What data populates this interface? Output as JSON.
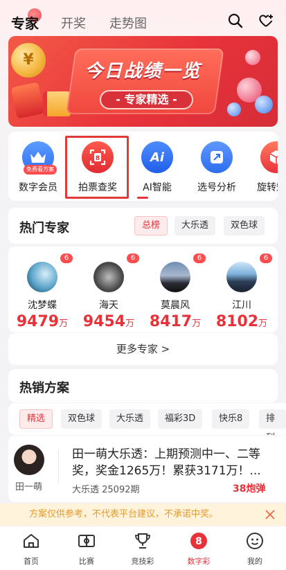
{
  "top_nav": {
    "tabs": [
      {
        "label": "专家",
        "active": true
      },
      {
        "label": "开奖",
        "active": false
      },
      {
        "label": "走势图",
        "active": false
      }
    ],
    "icons": [
      "search-icon",
      "heart-plus-icon"
    ]
  },
  "banner": {
    "title": "今日战绩一览",
    "subtitle": "- 专家精选 -",
    "coin_symbol": "¥"
  },
  "quick_functions": [
    {
      "label": "数字会员",
      "icon": "crown-icon",
      "badge": "免费看方案",
      "color": "#3b82f6"
    },
    {
      "label": "拍票查奖",
      "icon": "scan-ticket-icon",
      "badge": "",
      "color": "#e8323a",
      "highlighted": true
    },
    {
      "label": "AI智能",
      "icon": "ai-icon",
      "badge": "",
      "color": "#2f6ff2"
    },
    {
      "label": "选号分析",
      "icon": "select-number-icon",
      "badge": "",
      "color": "#3d7bf7"
    },
    {
      "label": "旋转矩阵",
      "icon": "cube-icon",
      "badge": "",
      "color": "#ef4b4b"
    }
  ],
  "hot_experts": {
    "title": "热门专家",
    "filters": [
      {
        "label": "总榜",
        "active": true
      },
      {
        "label": "大乐透",
        "active": false
      },
      {
        "label": "双色球",
        "active": false
      }
    ],
    "experts": [
      {
        "name": "沈梦蝶",
        "value": "9479",
        "unit": "万",
        "badge": "6"
      },
      {
        "name": "海天",
        "value": "9454",
        "unit": "万",
        "badge": "6"
      },
      {
        "name": "莫晨风",
        "value": "8417",
        "unit": "万",
        "badge": "6"
      },
      {
        "name": "江川",
        "value": "8102",
        "unit": "万",
        "badge": "6"
      }
    ],
    "more_label": "更多专家 >"
  },
  "hot_plans": {
    "title": "热销方案",
    "filters": [
      {
        "label": "精选",
        "active": true
      },
      {
        "label": "双色球",
        "active": false
      },
      {
        "label": "大乐透",
        "active": false
      },
      {
        "label": "福彩3D",
        "active": false
      },
      {
        "label": "快乐8",
        "active": false
      },
      {
        "label": "排列",
        "active": false
      }
    ],
    "item": {
      "author": "田一萌",
      "title": "田一萌大乐透：上期预测中一、二等奖，奖金1265万！累获3171万！...",
      "meta": "大乐透 25092期",
      "count": "38炮弹"
    }
  },
  "notice": {
    "text": "方案仅供参考，不代表平台建议，不承诺中奖。"
  },
  "bottom_nav": [
    {
      "label": "首页",
      "icon": "home-icon",
      "active": false
    },
    {
      "label": "比赛",
      "icon": "match-icon",
      "active": false
    },
    {
      "label": "竞技彩",
      "icon": "trophy-icon",
      "active": false
    },
    {
      "label": "数字彩",
      "icon": "lottery-8-icon",
      "active": true,
      "glyph": "8"
    },
    {
      "label": "我的",
      "icon": "profile-icon",
      "active": false
    }
  ],
  "colors": {
    "accent": "#e8323a",
    "notice_bg": "#fff3dc",
    "notice_text": "#e89a2a"
  }
}
